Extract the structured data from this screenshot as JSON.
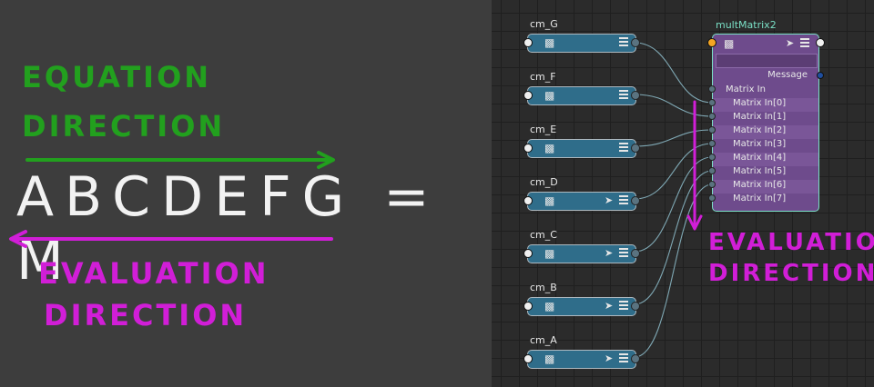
{
  "left_panel": {
    "equation_label_1": "EQUATION",
    "equation_label_2": "DIRECTION",
    "equation": "ABCDEFG = M",
    "evaluation_label_1": "EVALUATION",
    "evaluation_label_2": "DIRECTION"
  },
  "node_editor": {
    "nodes": [
      {
        "label": "cm_G",
        "has_pin": false
      },
      {
        "label": "cm_F",
        "has_pin": false
      },
      {
        "label": "cm_E",
        "has_pin": false
      },
      {
        "label": "cm_D",
        "has_pin": true
      },
      {
        "label": "cm_C",
        "has_pin": true
      },
      {
        "label": "cm_B",
        "has_pin": true
      },
      {
        "label": "cm_A",
        "has_pin": true
      }
    ],
    "mult_matrix": {
      "title": "multMatrix2",
      "message": "Message",
      "matrix_in": "Matrix In",
      "inputs": [
        "Matrix In[0]",
        "Matrix In[1]",
        "Matrix In[2]",
        "Matrix In[3]",
        "Matrix In[4]",
        "Matrix In[5]",
        "Matrix In[6]",
        "Matrix In[7]"
      ]
    },
    "evaluation_label_1": "EVALUATION",
    "evaluation_label_2": "DIRECTION"
  },
  "colors": {
    "green": "#22a01e",
    "magenta": "#d11ed7",
    "node_blue": "#2f6d8a",
    "node_purple": "#6e4b8c",
    "node_border_selected": "#7ae0c6"
  },
  "icons": [
    "cube-icon",
    "pin-icon",
    "stack-icon"
  ]
}
